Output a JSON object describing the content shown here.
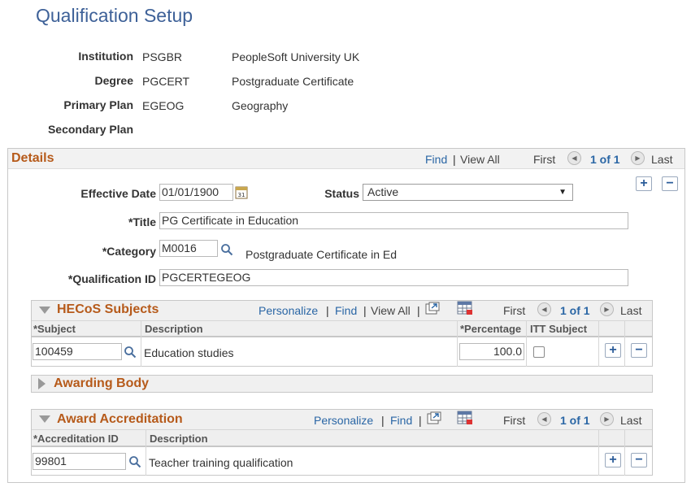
{
  "page": {
    "title": "Qualification Setup"
  },
  "header": {
    "institution_label": "Institution",
    "institution_code": "PSGBR",
    "institution_desc": "PeopleSoft University UK",
    "degree_label": "Degree",
    "degree_code": "PGCERT",
    "degree_desc": "Postgraduate Certificate",
    "primary_plan_label": "Primary Plan",
    "primary_plan_code": "EGEOG",
    "primary_plan_desc": "Geography",
    "secondary_plan_label": "Secondary Plan"
  },
  "details": {
    "title": "Details",
    "find": "Find",
    "sep": "|",
    "view_all": "View All",
    "first": "First",
    "count": "1 of 1",
    "last": "Last",
    "effective_date_label": "Effective Date",
    "effective_date": "01/01/1900",
    "status_label": "Status",
    "status": "Active",
    "title_label": "*Title",
    "title_value": "PG Certificate in Education",
    "category_label": "*Category",
    "category_value": "M0016",
    "category_desc": "Postgraduate Certificate in Ed",
    "qualification_id_label": "*Qualification ID",
    "qualification_id": "PGCERTEGEOG"
  },
  "hecos": {
    "title": "HECoS Subjects",
    "personalize": "Personalize",
    "find": "Find",
    "view_all": "View All",
    "first": "First",
    "count": "1 of 1",
    "last": "Last",
    "columns": [
      "*Subject",
      "Description",
      "*Percentage",
      "ITT Subject"
    ],
    "rows": [
      {
        "subject": "100459",
        "description": "Education studies",
        "percentage": "100.0"
      }
    ]
  },
  "awarding_body": {
    "title": "Awarding Body"
  },
  "accreditation": {
    "title": "Award Accreditation",
    "personalize": "Personalize",
    "find": "Find",
    "first": "First",
    "count": "1 of 1",
    "last": "Last",
    "columns": [
      "*Accreditation ID",
      "Description"
    ],
    "rows": [
      {
        "id": "99801",
        "description": "Teacher training qualification"
      }
    ]
  },
  "glyphs": {
    "plus": "+",
    "minus": "−",
    "caret": "▼",
    "prev": "◀",
    "next": "▶"
  },
  "colors": {
    "title_blue": "#3e6198",
    "section_orange": "#b65a1a",
    "link_blue": "#2a66a5"
  }
}
